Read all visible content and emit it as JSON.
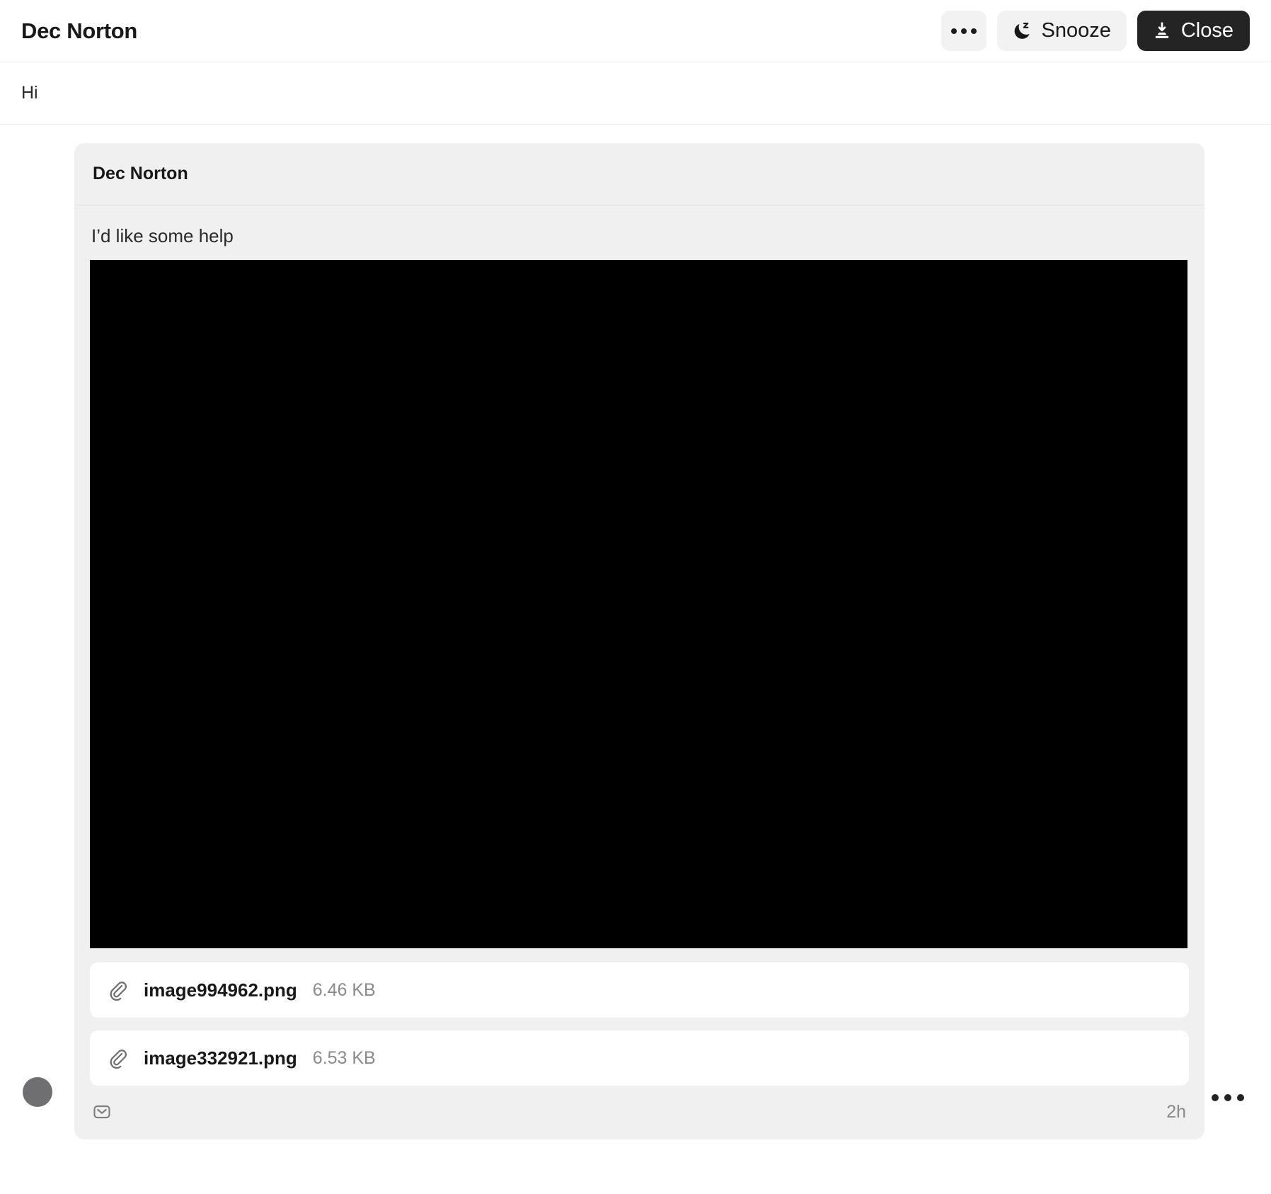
{
  "header": {
    "title": "Dec Norton",
    "more_button": {
      "label": "",
      "icon": "ellipsis-icon"
    },
    "snooze_button": {
      "label": "Snooze",
      "icon": "moon-zzz-icon"
    },
    "close_button": {
      "label": "Close",
      "icon": "archive-download-icon"
    }
  },
  "subject": {
    "text": "Hi"
  },
  "message": {
    "sender": "Dec Norton",
    "body": "I’d like some help",
    "embedded_image_alt": "",
    "attachments": [
      {
        "icon": "paperclip-icon",
        "name": "image994962.png",
        "size": "6.46 KB"
      },
      {
        "icon": "paperclip-icon",
        "name": "image332921.png",
        "size": "6.53 KB"
      }
    ],
    "footer": {
      "channel_icon": "envelope-icon",
      "timestamp": "2h"
    },
    "menu_icon": "ellipsis-icon"
  },
  "colors": {
    "page_background": "#ffffff",
    "card_background": "#f0f0f0",
    "attachment_background": "#ffffff",
    "close_button_background": "#242424",
    "ghost_button_background": "#f2f2f2",
    "avatar": "#6f6e70",
    "muted_text": "#8a8a8e",
    "primary_text": "#18181a",
    "image_placeholder": "#000000",
    "divider": "#ebebeb"
  }
}
